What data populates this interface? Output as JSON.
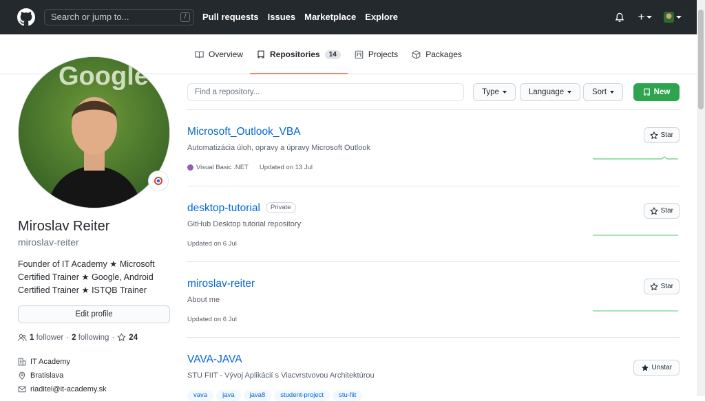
{
  "header": {
    "search_placeholder": "Search or jump to...",
    "search_shortcut": "/",
    "nav": [
      "Pull requests",
      "Issues",
      "Marketplace",
      "Explore"
    ],
    "plus_label": "+"
  },
  "tabs": [
    {
      "label": "Overview",
      "icon": "book-icon"
    },
    {
      "label": "Repositories",
      "icon": "repo-icon",
      "count": "14",
      "selected": true
    },
    {
      "label": "Projects",
      "icon": "project-icon"
    },
    {
      "label": "Packages",
      "icon": "package-icon"
    }
  ],
  "profile": {
    "full_name": "Miroslav Reiter",
    "username": "miroslav-reiter",
    "bio": "Founder of IT Academy ★ Microsoft Certified Trainer ★ Google, Android Certified Trainer ★ ISTQB Trainer",
    "edit_label": "Edit profile",
    "followers_count": "1",
    "followers_label": "follower",
    "following_count": "2",
    "following_label": "following",
    "stars_count": "24",
    "separator": "·",
    "company": "IT Academy",
    "location": "Bratislava",
    "email": "riaditel@it-academy.sk",
    "avatar_text": "Google"
  },
  "filters": {
    "find_placeholder": "Find a repository...",
    "type_label": "Type",
    "language_label": "Language",
    "sort_label": "Sort",
    "new_label": "New"
  },
  "repos": [
    {
      "name": "Microsoft_Outlook_VBA",
      "description": "Automatizácia úloh, opravy a úpravy Microsoft Outlook",
      "language": "Visual Basic .NET",
      "language_color": "#945db7",
      "updated": "Updated on 13 Jul",
      "star_label": "Star"
    },
    {
      "name": "desktop-tutorial",
      "badge": "Private",
      "description": "GitHub Desktop tutorial repository",
      "updated": "Updated on 6 Jul",
      "star_label": "Star"
    },
    {
      "name": "miroslav-reiter",
      "description": "About me",
      "updated": "Updated on 6 Jul",
      "star_label": "Star"
    },
    {
      "name": "VAVA-JAVA",
      "description": "STU FIIT - Vývoj Aplikácií s Viacvrstvovou Architektúrou",
      "star_label": "Unstar",
      "topics": [
        "vava",
        "java",
        "java8",
        "student-project",
        "stu-fiit"
      ]
    }
  ],
  "colors": {
    "header_bg": "#24292e",
    "link": "#0366d6",
    "new_button": "#2ea44f",
    "tab_underline": "#f9826c",
    "spark": "#40c463"
  }
}
